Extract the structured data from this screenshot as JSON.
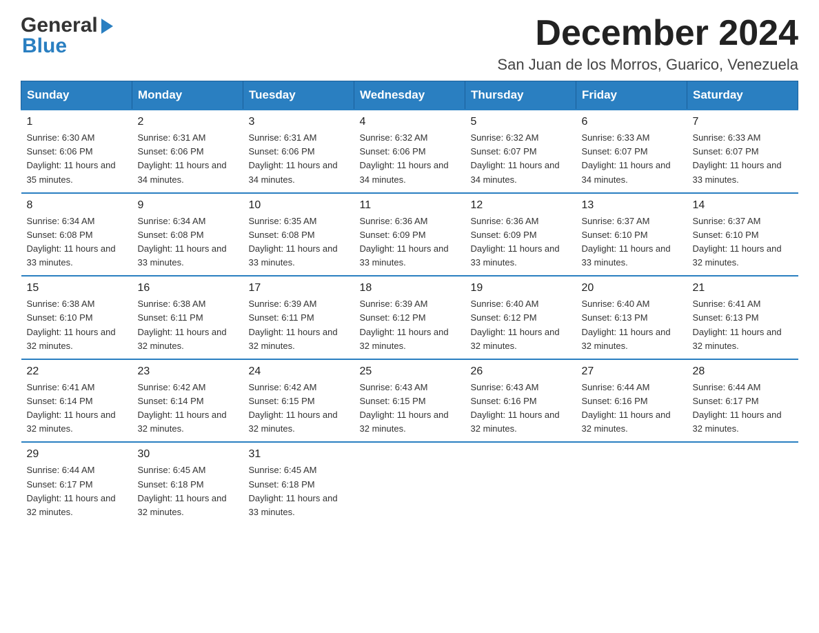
{
  "header": {
    "logo_general": "General",
    "logo_arrow": "▶",
    "logo_blue": "Blue",
    "month_title": "December 2024",
    "location": "San Juan de los Morros, Guarico, Venezuela"
  },
  "days_of_week": [
    "Sunday",
    "Monday",
    "Tuesday",
    "Wednesday",
    "Thursday",
    "Friday",
    "Saturday"
  ],
  "weeks": [
    [
      {
        "day": "1",
        "sunrise": "6:30 AM",
        "sunset": "6:06 PM",
        "daylight": "11 hours and 35 minutes."
      },
      {
        "day": "2",
        "sunrise": "6:31 AM",
        "sunset": "6:06 PM",
        "daylight": "11 hours and 34 minutes."
      },
      {
        "day": "3",
        "sunrise": "6:31 AM",
        "sunset": "6:06 PM",
        "daylight": "11 hours and 34 minutes."
      },
      {
        "day": "4",
        "sunrise": "6:32 AM",
        "sunset": "6:06 PM",
        "daylight": "11 hours and 34 minutes."
      },
      {
        "day": "5",
        "sunrise": "6:32 AM",
        "sunset": "6:07 PM",
        "daylight": "11 hours and 34 minutes."
      },
      {
        "day": "6",
        "sunrise": "6:33 AM",
        "sunset": "6:07 PM",
        "daylight": "11 hours and 34 minutes."
      },
      {
        "day": "7",
        "sunrise": "6:33 AM",
        "sunset": "6:07 PM",
        "daylight": "11 hours and 33 minutes."
      }
    ],
    [
      {
        "day": "8",
        "sunrise": "6:34 AM",
        "sunset": "6:08 PM",
        "daylight": "11 hours and 33 minutes."
      },
      {
        "day": "9",
        "sunrise": "6:34 AM",
        "sunset": "6:08 PM",
        "daylight": "11 hours and 33 minutes."
      },
      {
        "day": "10",
        "sunrise": "6:35 AM",
        "sunset": "6:08 PM",
        "daylight": "11 hours and 33 minutes."
      },
      {
        "day": "11",
        "sunrise": "6:36 AM",
        "sunset": "6:09 PM",
        "daylight": "11 hours and 33 minutes."
      },
      {
        "day": "12",
        "sunrise": "6:36 AM",
        "sunset": "6:09 PM",
        "daylight": "11 hours and 33 minutes."
      },
      {
        "day": "13",
        "sunrise": "6:37 AM",
        "sunset": "6:10 PM",
        "daylight": "11 hours and 33 minutes."
      },
      {
        "day": "14",
        "sunrise": "6:37 AM",
        "sunset": "6:10 PM",
        "daylight": "11 hours and 32 minutes."
      }
    ],
    [
      {
        "day": "15",
        "sunrise": "6:38 AM",
        "sunset": "6:10 PM",
        "daylight": "11 hours and 32 minutes."
      },
      {
        "day": "16",
        "sunrise": "6:38 AM",
        "sunset": "6:11 PM",
        "daylight": "11 hours and 32 minutes."
      },
      {
        "day": "17",
        "sunrise": "6:39 AM",
        "sunset": "6:11 PM",
        "daylight": "11 hours and 32 minutes."
      },
      {
        "day": "18",
        "sunrise": "6:39 AM",
        "sunset": "6:12 PM",
        "daylight": "11 hours and 32 minutes."
      },
      {
        "day": "19",
        "sunrise": "6:40 AM",
        "sunset": "6:12 PM",
        "daylight": "11 hours and 32 minutes."
      },
      {
        "day": "20",
        "sunrise": "6:40 AM",
        "sunset": "6:13 PM",
        "daylight": "11 hours and 32 minutes."
      },
      {
        "day": "21",
        "sunrise": "6:41 AM",
        "sunset": "6:13 PM",
        "daylight": "11 hours and 32 minutes."
      }
    ],
    [
      {
        "day": "22",
        "sunrise": "6:41 AM",
        "sunset": "6:14 PM",
        "daylight": "11 hours and 32 minutes."
      },
      {
        "day": "23",
        "sunrise": "6:42 AM",
        "sunset": "6:14 PM",
        "daylight": "11 hours and 32 minutes."
      },
      {
        "day": "24",
        "sunrise": "6:42 AM",
        "sunset": "6:15 PM",
        "daylight": "11 hours and 32 minutes."
      },
      {
        "day": "25",
        "sunrise": "6:43 AM",
        "sunset": "6:15 PM",
        "daylight": "11 hours and 32 minutes."
      },
      {
        "day": "26",
        "sunrise": "6:43 AM",
        "sunset": "6:16 PM",
        "daylight": "11 hours and 32 minutes."
      },
      {
        "day": "27",
        "sunrise": "6:44 AM",
        "sunset": "6:16 PM",
        "daylight": "11 hours and 32 minutes."
      },
      {
        "day": "28",
        "sunrise": "6:44 AM",
        "sunset": "6:17 PM",
        "daylight": "11 hours and 32 minutes."
      }
    ],
    [
      {
        "day": "29",
        "sunrise": "6:44 AM",
        "sunset": "6:17 PM",
        "daylight": "11 hours and 32 minutes."
      },
      {
        "day": "30",
        "sunrise": "6:45 AM",
        "sunset": "6:18 PM",
        "daylight": "11 hours and 32 minutes."
      },
      {
        "day": "31",
        "sunrise": "6:45 AM",
        "sunset": "6:18 PM",
        "daylight": "11 hours and 33 minutes."
      },
      null,
      null,
      null,
      null
    ]
  ],
  "colors": {
    "header_bg": "#2a7fc1",
    "header_text": "#ffffff",
    "border_top": "#2a7fc1",
    "text": "#333333"
  }
}
